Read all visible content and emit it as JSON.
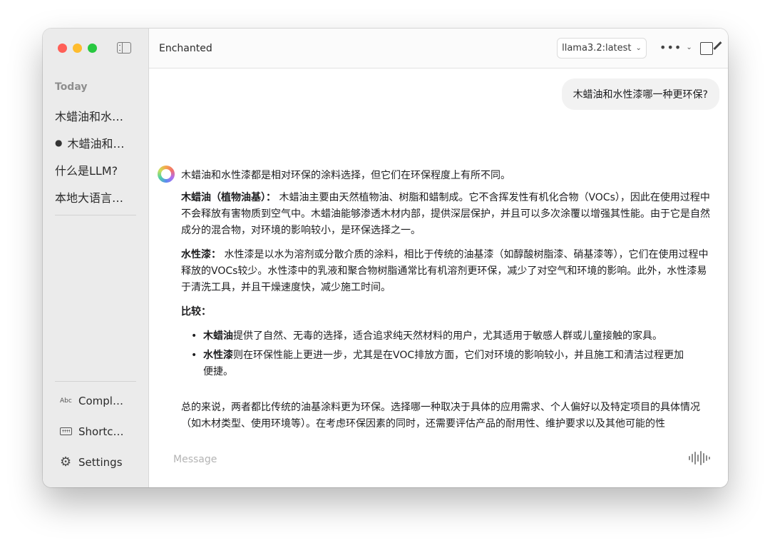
{
  "sidebar": {
    "section_label": "Today",
    "conversations": [
      {
        "label": "木蜡油和水…",
        "active": false
      },
      {
        "label": "木蜡油和…",
        "active": true
      },
      {
        "label": "什么是LLM?",
        "active": false
      },
      {
        "label": "本地大语言…",
        "active": false
      }
    ],
    "bottom": {
      "completions_icon": "Abc",
      "completions_label": "Compl…",
      "shortcuts_label": "Shortc…",
      "settings_label": "Settings"
    }
  },
  "header": {
    "title": "Enchanted",
    "model": "llama3.2:latest",
    "more_label": "•••"
  },
  "chat": {
    "user_message": "木蜡油和水性漆哪一种更环保?",
    "assistant": {
      "lead": "木蜡油和水性漆都是相对环保的涂料选择，但它们在环保程度上有所不同。",
      "p1_title": "木蜡油（植物油基）：",
      "p1_text": " 木蜡油主要由天然植物油、树脂和蜡制成。它不含挥发性有机化合物（VOCs），因此在使用过程中不会释放有害物质到空气中。木蜡油能够渗透木材内部，提供深层保护，并且可以多次涂覆以增强其性能。由于它是自然成分的混合物，对环境的影响较小，是环保选择之一。",
      "p2_title": "水性漆：",
      "p2_text": " 水性漆是以水为溶剂或分散介质的涂料，相比于传统的油基漆（如醇酸树脂漆、硝基漆等），它们在使用过程中释放的VOCs较少。水性漆中的乳液和聚合物树脂通常比有机溶剂更环保，减少了对空气和环境的影响。此外，水性漆易于清洗工具，并且干燥速度快，减少施工时间。",
      "compare_title": "比较：",
      "bullet1_title": "木蜡油",
      "bullet1_text": "提供了自然、无毒的选择，适合追求纯天然材料的用户，尤其适用于敏感人群或儿童接触的家具。",
      "bullet2_title": "水性漆",
      "bullet2_text": "则在环保性能上更进一步，尤其是在VOC排放方面，它们对环境的影响较小，并且施工和清洁过程更加便捷。",
      "summary": "总的来说，两者都比传统的油基涂料更为环保。选择哪一种取决于具体的应用需求、个人偏好以及特定项目的具体情况（如木材类型、使用环境等）。在考虑环保因素的同时，还需要评估产品的耐用性、维护要求以及其他可能的性"
    }
  },
  "composer": {
    "placeholder": "Message"
  }
}
